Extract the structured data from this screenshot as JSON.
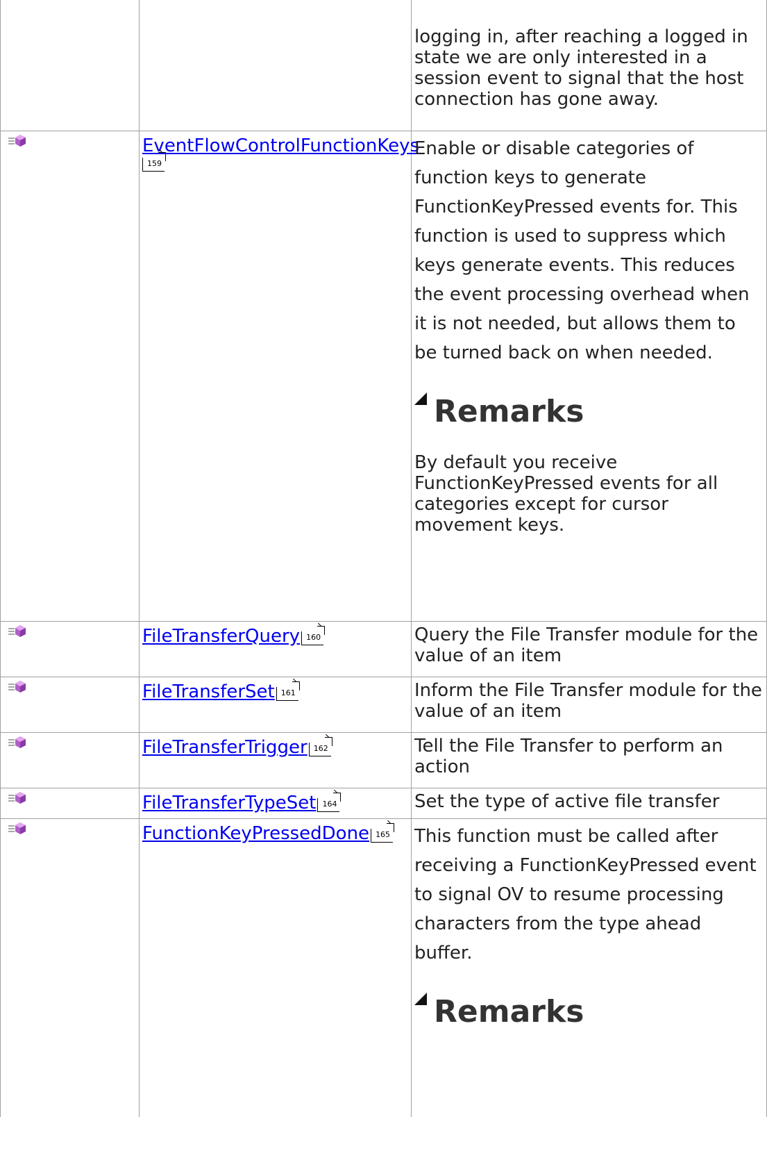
{
  "rows": [
    {
      "description": "logging in, after reaching a logged in state we are only interested in a session event to signal that the host connection has gone away."
    },
    {
      "icon": "method-icon",
      "name": "EventFlowControlFunctionKeys",
      "page": "159",
      "description": "Enable or disable categories of function keys to generate FunctionKeyPressed events for. This function is used to suppress which keys generate events. This reduces the event processing overhead when it is not needed, but allows them to be turned back on when needed.",
      "remarks_heading": "Remarks",
      "remarks_text": "By default you receive FunctionKeyPressed events for all categories except for cursor movement keys."
    },
    {
      "icon": "method-icon",
      "name": "FileTransferQuery",
      "page": "160",
      "description": "Query the File Transfer module for the value of an item"
    },
    {
      "icon": "method-icon",
      "name": "FileTransferSet",
      "page": "161",
      "description": "Inform the File Transfer module for the value of an item"
    },
    {
      "icon": "method-icon",
      "name": "FileTransferTrigger",
      "page": "162",
      "description": "Tell the File Transfer to perform an action"
    },
    {
      "icon": "method-icon",
      "name": "FileTransferTypeSet",
      "page": "164",
      "description": "Set the type of active file transfer"
    },
    {
      "icon": "method-icon",
      "name": "FunctionKeyPressedDone",
      "page": "165",
      "description": "This function must be called after receiving a FunctionKeyPressed event to signal OV to resume processing characters from the type ahead buffer.",
      "remarks_heading": "Remarks"
    }
  ]
}
